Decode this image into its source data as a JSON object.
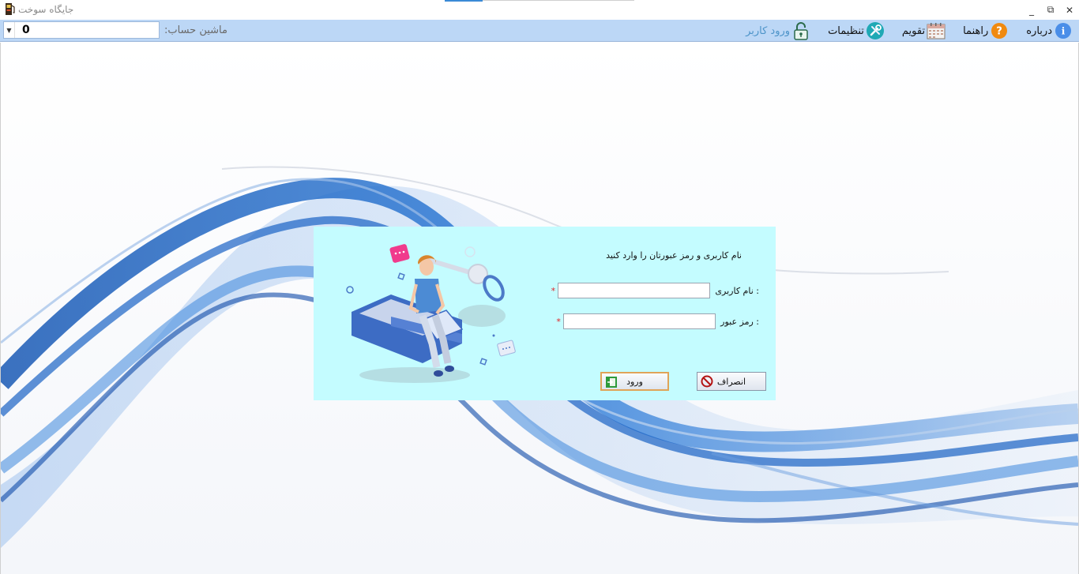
{
  "window": {
    "title": "جایگاه سوخت",
    "controls": {
      "minimize": "_",
      "restore": "⧉",
      "close": "✕"
    }
  },
  "toolbar": {
    "account_label": "ماشین حساب:",
    "account_value": "0",
    "menu": [
      {
        "label": "ورود کاربر",
        "icon": "lock-open-icon"
      },
      {
        "label": "تنظیمات",
        "icon": "tools-icon"
      },
      {
        "label": "تقویم",
        "icon": "calendar-icon"
      },
      {
        "label": "راهنما",
        "icon": "help-icon"
      },
      {
        "label": "درباره",
        "icon": "info-icon"
      }
    ]
  },
  "login": {
    "title": "نام کاربری و رمز عبورتان را وارد کنید",
    "username_label": ": نام کاربری",
    "password_label": ": رمز عبور",
    "required_mark": "*",
    "username_value": "",
    "password_value": "",
    "login_button": "ورود",
    "cancel_button": "انصراف"
  },
  "colors": {
    "toolbar_bg": "#bcd7f6",
    "dialog_bg": "#c4fcff",
    "accent_blue": "#1e6fd0",
    "required": "#e0262a"
  }
}
